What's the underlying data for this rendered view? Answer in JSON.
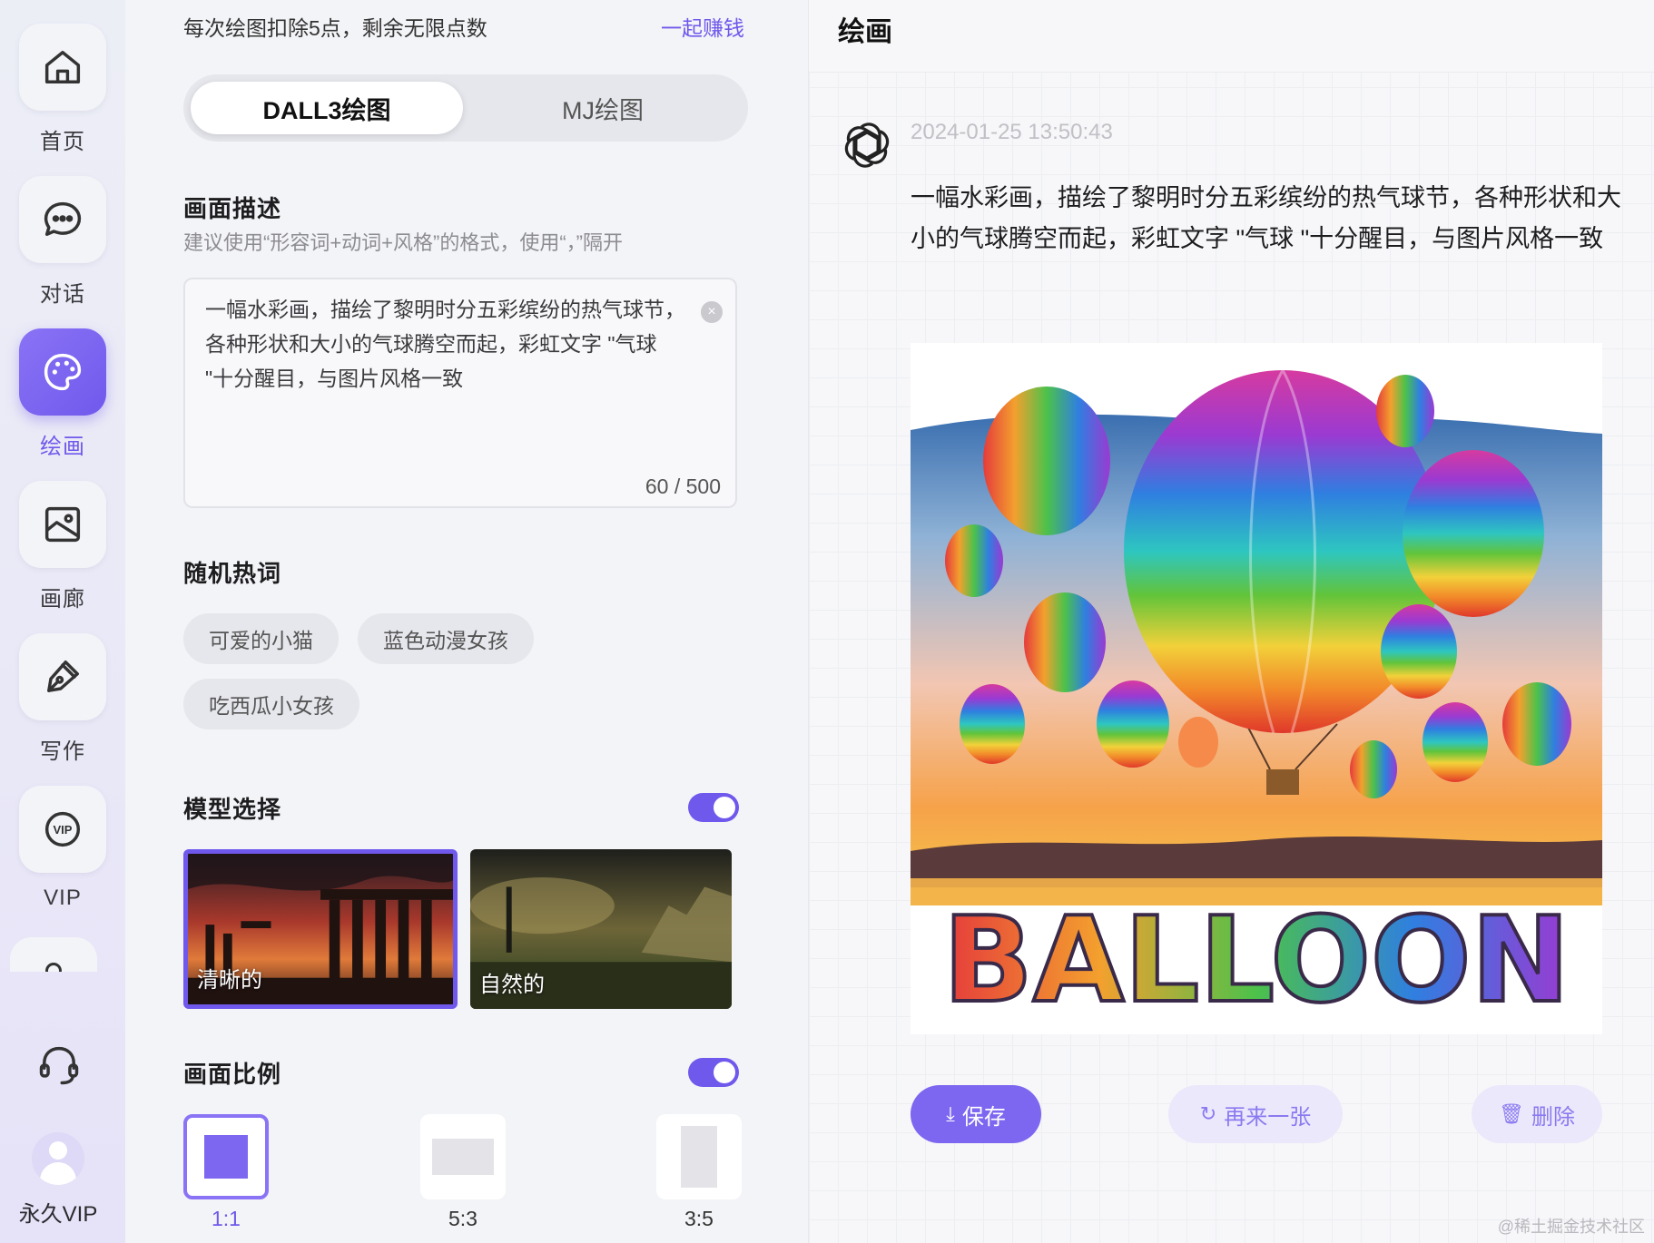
{
  "nav": {
    "items": [
      {
        "label": "首页",
        "icon": "home-icon"
      },
      {
        "label": "对话",
        "icon": "chat-icon"
      },
      {
        "label": "绘画",
        "icon": "palette-icon"
      },
      {
        "label": "画廊",
        "icon": "gallery-icon"
      },
      {
        "label": "写作",
        "icon": "pen-icon"
      },
      {
        "label": "VIP",
        "icon": "vip-icon"
      }
    ],
    "active": "绘画",
    "user_label": "永久VIP"
  },
  "panel": {
    "cost_note": "每次绘图扣除5点，剩余无限点数",
    "earn_link": "一起赚钱",
    "tabs": {
      "dalle": "DALL3绘图",
      "mj": "MJ绘图"
    },
    "desc_title": "画面描述",
    "desc_hint": "建议使用“形容词+动词+风格”的格式，使用“，”隔开",
    "prompt_value": "一幅水彩画，描绘了黎明时分五彩缤纷的热气球节，各种形状和大小的气球腾空而起，彩虹文字 \"气球 \"十分醒目，与图片风格一致",
    "char_count": "60 / 500",
    "hot_title": "随机热词",
    "hot_words": [
      "可爱的小猫",
      "蓝色动漫女孩",
      "吃西瓜小女孩"
    ],
    "model_title": "模型选择",
    "models": [
      "清晰的",
      "自然的"
    ],
    "ratio_title": "画面比例",
    "ratios": [
      "1:1",
      "5:3",
      "3:5"
    ]
  },
  "result": {
    "title": "绘画",
    "timestamp": "2024-01-25 13:50:43",
    "message": "一幅水彩画，描绘了黎明时分五彩缤纷的热气球节，各种形状和大小的气球腾空而起，彩虹文字 \"气球 \"十分醒目，与图片风格一致",
    "image_text": "BALLOON",
    "buttons": {
      "save": "保存",
      "again": "再来一张",
      "delete": "删除"
    },
    "watermark": "@稀土掘金技术社区"
  },
  "colors": {
    "accent": "#6f58ec",
    "accent_light": "#ebe8fb"
  }
}
